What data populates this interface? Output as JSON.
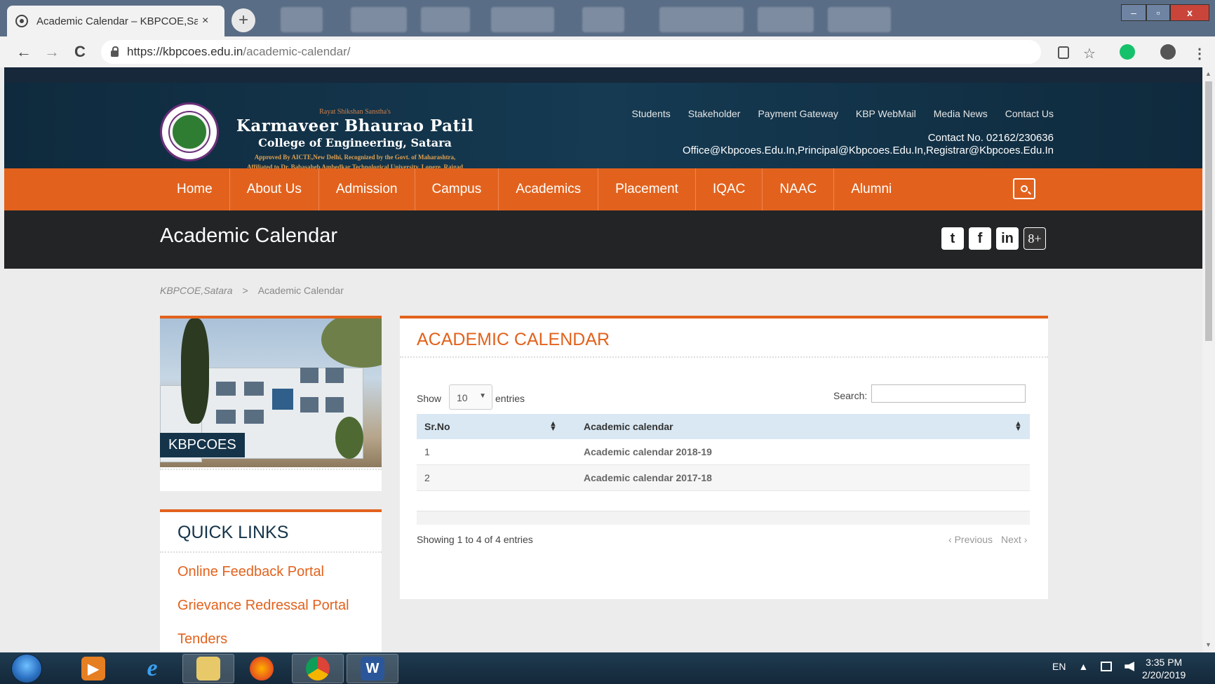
{
  "browser": {
    "tab_title": "Academic Calendar – KBPCOE,Sa",
    "tab_close": "×",
    "new_tab": "+",
    "url_domain": "https://kbpcoes.edu.in",
    "url_path": "/academic-calendar/",
    "back": "←",
    "forward": "→",
    "reload": "C",
    "star": "☆",
    "menu": "⋮",
    "win_min": "–",
    "win_max": "▫",
    "win_close": "x"
  },
  "header": {
    "kicker": "Rayat Shikshan Sanstha's",
    "college_name": "Karmaveer Bhaurao Patil",
    "college_sub": "College of Engineering, Satara",
    "approval_1": "Approved By AICTE,New Delhi, Recognized by the Govt. of Maharashtra,",
    "approval_2": "Affiliated to Dr. Babasaheb Ambedkar Technological University, Lonere, Raigad",
    "toplinks": [
      "Students",
      "Stakeholder",
      "Payment Gateway",
      "KBP WebMail",
      "Media News",
      "Contact Us"
    ],
    "contact_no": "Contact No. 02162/230636",
    "emails": "Office@Kbpcoes.Edu.In,Principal@Kbpcoes.Edu.In,Registrar@Kbpcoes.Edu.In"
  },
  "nav": {
    "items": [
      "Home",
      "About Us",
      "Admission",
      "Campus",
      "Academics",
      "Placement",
      "IQAC",
      "NAAC",
      "Alumni"
    ]
  },
  "page": {
    "title": "Academic Calendar",
    "social": [
      "t",
      "f",
      "in",
      "8+"
    ],
    "breadcrumb_home": "KBPCOE,Satara",
    "breadcrumb_sep": ">",
    "breadcrumb_current": "Academic Calendar"
  },
  "sidebar": {
    "photo_label": "KBPCOES",
    "quicklinks_title": "QUICK LINKS",
    "quicklinks": [
      "Online Feedback Portal",
      "Grievance Redressal Portal",
      "Tenders"
    ]
  },
  "panel": {
    "title": "ACADEMIC CALENDAR",
    "show_label": "Show",
    "length_value": "10",
    "entries_label": "entries",
    "search_label": "Search:",
    "columns": [
      "Sr.No",
      "Academic calendar"
    ],
    "rows": [
      [
        "1",
        "Academic calendar 2018-19"
      ],
      [
        "2",
        "Academic calendar 2017-18"
      ]
    ],
    "info": "Showing 1 to 4 of 4 entries",
    "prev": "Previous",
    "next": "Next"
  },
  "taskbar": {
    "lang": "EN",
    "time": "3:35 PM",
    "date": "2/20/2019"
  },
  "colors": {
    "accent": "#e2621d",
    "header_bg": "#0f2a3d",
    "title_bar": "#222426",
    "table_head": "#d9e8f3"
  }
}
